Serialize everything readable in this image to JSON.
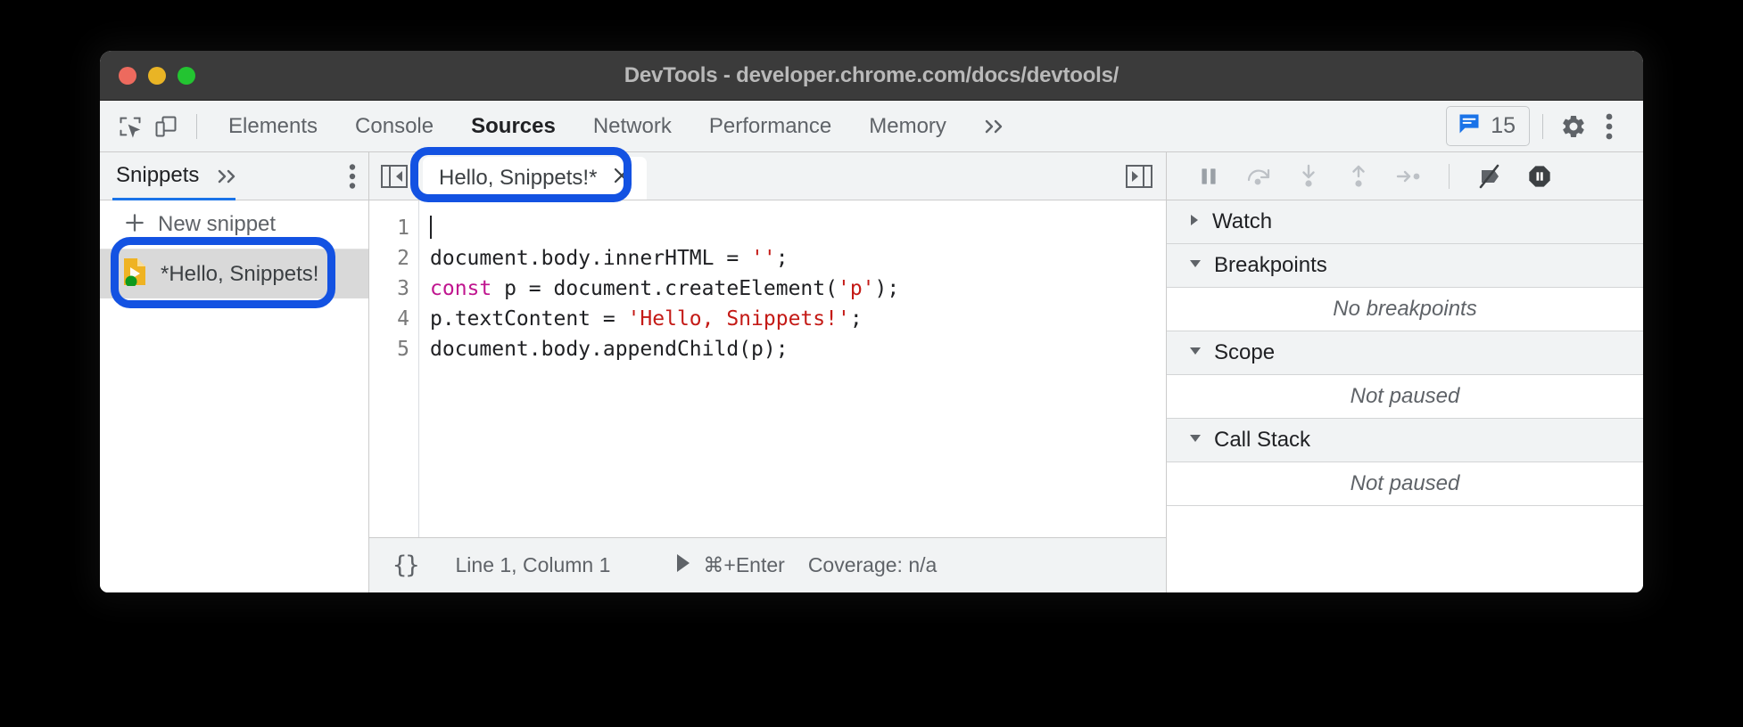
{
  "window": {
    "title": "DevTools - developer.chrome.com/docs/devtools/",
    "traffic_lights": [
      "close",
      "minimize",
      "maximize"
    ]
  },
  "colors": {
    "accent_blue": "#1a73e8",
    "callout_blue": "#1352e2",
    "toolbar_bg": "#f1f3f4",
    "titlebar_bg": "#3b3b3b",
    "selected_row_bg": "#d9d9d9",
    "keyword_magenta": "#c0158f",
    "string_red": "#c41a16",
    "snippet_icon_orange": "#efb323",
    "snippet_badge_green": "#0e9a1e"
  },
  "toolbar": {
    "inspect_icon": "inspect-element-icon",
    "device_icon": "device-toolbar-icon",
    "tabs": [
      {
        "label": "Elements",
        "active": false
      },
      {
        "label": "Console",
        "active": false
      },
      {
        "label": "Sources",
        "active": true
      },
      {
        "label": "Network",
        "active": false
      },
      {
        "label": "Performance",
        "active": false
      },
      {
        "label": "Memory",
        "active": false
      }
    ],
    "more_tabs_icon": "chevron-double-right-icon",
    "issues": {
      "icon": "issues-message-icon",
      "count": "15"
    },
    "settings_icon": "gear-icon",
    "kebab_icon": "more-vertical-icon"
  },
  "navigator": {
    "tab_label": "Snippets",
    "more_icon": "chevron-double-right-icon",
    "kebab_icon": "more-vertical-icon",
    "new_snippet_label": "New snippet",
    "new_snippet_icon": "plus-icon",
    "snippets": [
      {
        "label": "*Hello, Snippets!",
        "icon": "snippet-file-icon",
        "badge": "green-dot-badge",
        "selected": true,
        "highlighted": true
      }
    ]
  },
  "editor": {
    "collapse_sidebar_icon": "collapse-navigator-icon",
    "run_panel_icon": "show-debugger-icon",
    "tab": {
      "name": "Hello, Snippets!*",
      "close_icon": "close-icon",
      "highlighted": true
    },
    "lines": [
      {
        "num": "1",
        "tokens": []
      },
      {
        "num": "2",
        "tokens": [
          {
            "t": "document.body.innerHTML = ",
            "c": "plain"
          },
          {
            "t": "''",
            "c": "str"
          },
          {
            "t": ";",
            "c": "plain"
          }
        ]
      },
      {
        "num": "3",
        "tokens": [
          {
            "t": "const",
            "c": "kw"
          },
          {
            "t": " p = document.createElement(",
            "c": "plain"
          },
          {
            "t": "'p'",
            "c": "str"
          },
          {
            "t": ");",
            "c": "plain"
          }
        ]
      },
      {
        "num": "4",
        "tokens": [
          {
            "t": "p.textContent = ",
            "c": "plain"
          },
          {
            "t": "'Hello, Snippets!'",
            "c": "str"
          },
          {
            "t": ";",
            "c": "plain"
          }
        ]
      },
      {
        "num": "5",
        "tokens": [
          {
            "t": "document.body.appendChild(p);",
            "c": "plain"
          }
        ]
      }
    ],
    "statusbar": {
      "format_label": "{}",
      "cursor_position": "Line 1, Column 1",
      "run_icon": "play-triangle-icon",
      "run_shortcut": "⌘+Enter",
      "coverage": "Coverage: n/a"
    }
  },
  "debugger": {
    "controls": [
      {
        "name": "pause-script-execution-icon"
      },
      {
        "name": "step-over-icon"
      },
      {
        "name": "step-into-icon"
      },
      {
        "name": "step-out-icon"
      },
      {
        "name": "step-icon"
      },
      {
        "name": "deactivate-breakpoints-icon"
      },
      {
        "name": "pause-on-exceptions-icon"
      }
    ],
    "sections": [
      {
        "title": "Watch",
        "expanded": false,
        "empty_text": null
      },
      {
        "title": "Breakpoints",
        "expanded": true,
        "empty_text": "No breakpoints"
      },
      {
        "title": "Scope",
        "expanded": true,
        "empty_text": "Not paused"
      },
      {
        "title": "Call Stack",
        "expanded": true,
        "empty_text": "Not paused"
      }
    ]
  }
}
